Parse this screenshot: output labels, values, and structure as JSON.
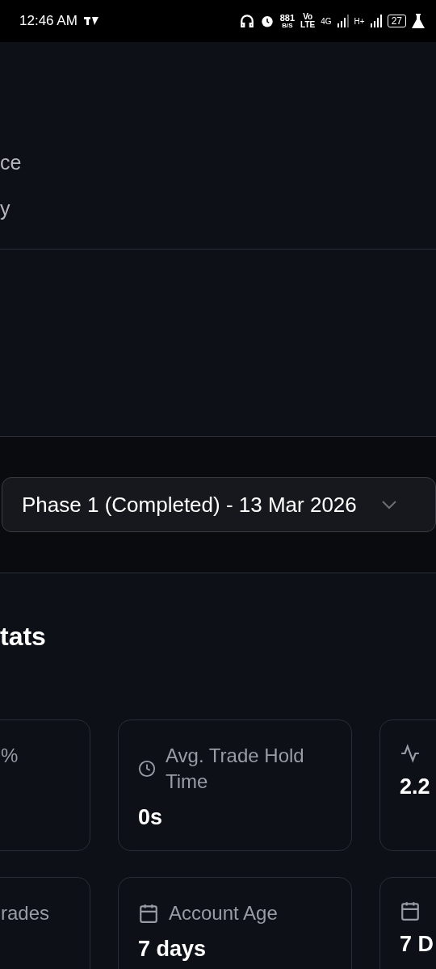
{
  "status_bar": {
    "time": "12:46 AM",
    "speed": "881",
    "speed_unit": "B/S",
    "volte_top": "Vo",
    "volte_bottom": "LTE",
    "network": "4G",
    "network2": "H+",
    "battery": "27"
  },
  "menu_items": [
    "ce",
    "y"
  ],
  "phase_select": {
    "value": "Phase 1 (Completed) - 13 Mar 2026"
  },
  "section_title": "tats",
  "stat_rows": [
    [
      {
        "kind": "plain",
        "label": "%"
      },
      {
        "kind": "duration",
        "label": "Avg. Trade Hold Time",
        "value": "0s"
      },
      {
        "kind": "ratio",
        "value": "2.2"
      }
    ],
    [
      {
        "kind": "plain",
        "label": "rades"
      },
      {
        "kind": "age",
        "label": "Account Age",
        "value": "7 days"
      },
      {
        "kind": "age",
        "value": "7 D"
      }
    ]
  ]
}
